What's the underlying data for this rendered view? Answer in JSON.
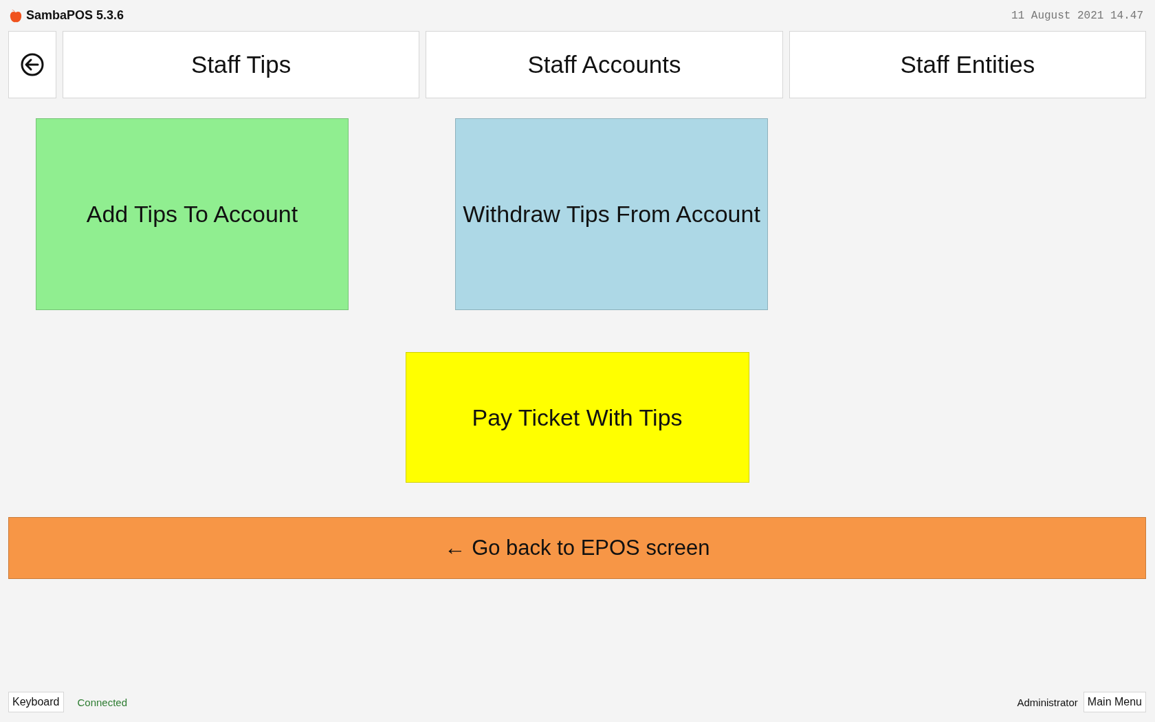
{
  "window": {
    "title": "SambaPOS 5.3.6",
    "datetime": "11 August 2021 14.47"
  },
  "tabs": [
    {
      "label": "Staff Tips"
    },
    {
      "label": "Staff Accounts"
    },
    {
      "label": "Staff Entities"
    }
  ],
  "tiles": [
    {
      "label": "Add Tips To Account",
      "color": "#90ee90"
    },
    {
      "label": "Withdraw Tips From Account",
      "color": "#add8e6"
    },
    {
      "label": "Pay Ticket With Tips",
      "color": "#ffff00"
    }
  ],
  "back_bar": {
    "label": "← Go back to EPOS screen",
    "color": "#f79646"
  },
  "status_bar": {
    "keyboard": "Keyboard",
    "connection": "Connected",
    "user": "Administrator",
    "menu": "Main Menu"
  }
}
